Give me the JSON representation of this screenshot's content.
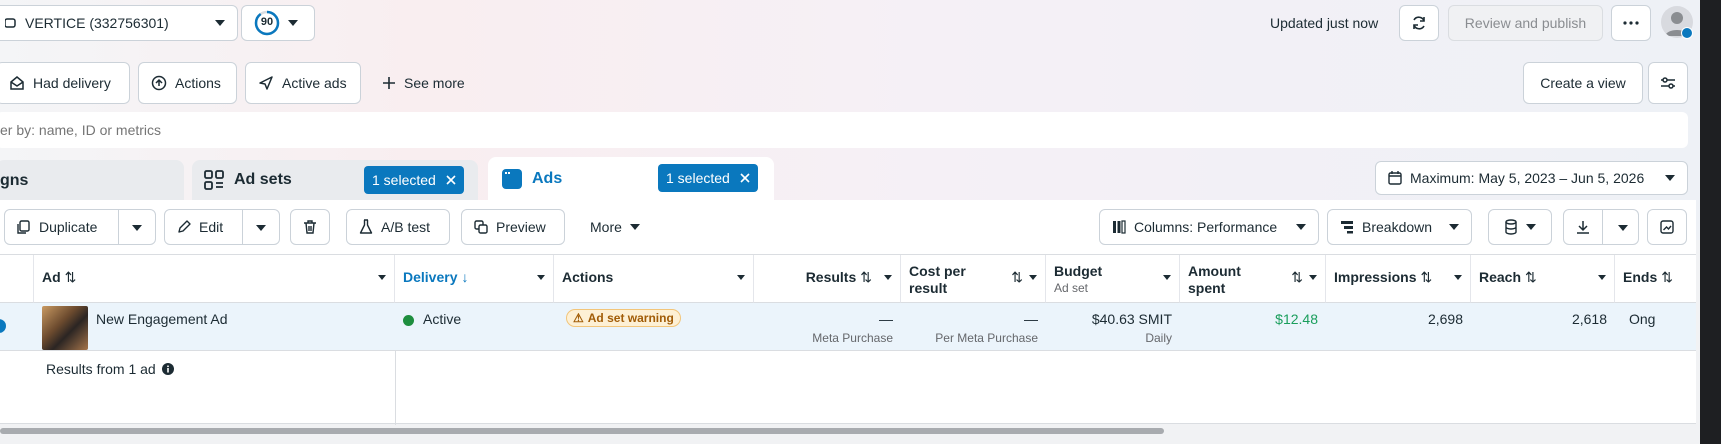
{
  "topbar": {
    "account_name": "VERTICE (332756301)",
    "score": "90",
    "updated_text": "Updated just now",
    "review_publish_label": "Review and publish"
  },
  "filters": {
    "had_delivery": "Had delivery",
    "actions": "Actions",
    "active_ads": "Active ads",
    "see_more": "See more",
    "create_view": "Create a view"
  },
  "search": {
    "placeholder": "er by: name, ID or metrics"
  },
  "tabs": {
    "campaigns_partial": "gns",
    "adsets": "Ad sets",
    "adsets_selected": "1 selected",
    "ads": "Ads",
    "ads_selected": "1 selected",
    "date_range": "Maximum: May 5, 2023 – Jun 5, 2026"
  },
  "toolbar": {
    "duplicate": "Duplicate",
    "edit": "Edit",
    "ab_test": "A/B test",
    "preview": "Preview",
    "more": "More",
    "columns": "Columns: Performance",
    "breakdown": "Breakdown"
  },
  "table": {
    "headers": {
      "ad": "Ad",
      "delivery": "Delivery",
      "actions": "Actions",
      "results": "Results",
      "cost_per_result_1": "Cost per",
      "cost_per_result_2": "result",
      "budget": "Budget",
      "budget_sub": "Ad set",
      "amount_spent_1": "Amount",
      "amount_spent_2": "spent",
      "impressions": "Impressions",
      "reach": "Reach",
      "ends": "Ends"
    },
    "row": {
      "ad_name": "New Engagement Ad",
      "delivery": "Active",
      "warning": "Ad set warning",
      "results": "—",
      "results_sub": "Meta Purchase",
      "cost": "—",
      "cost_sub": "Per Meta Purchase",
      "budget": "$40.63 SMIT",
      "budget_sub": "Daily",
      "amount_spent": "$12.48",
      "impressions": "2,698",
      "reach": "2,618",
      "ends": "Ong"
    },
    "footer": "Results from 1 ad"
  },
  "colors": {
    "accent": "#0a78be",
    "active_green": "#1e8e3e",
    "spent_green": "#1a9e5c",
    "warning_bg": "#fdf0d5",
    "warning_text": "#a15c07"
  }
}
